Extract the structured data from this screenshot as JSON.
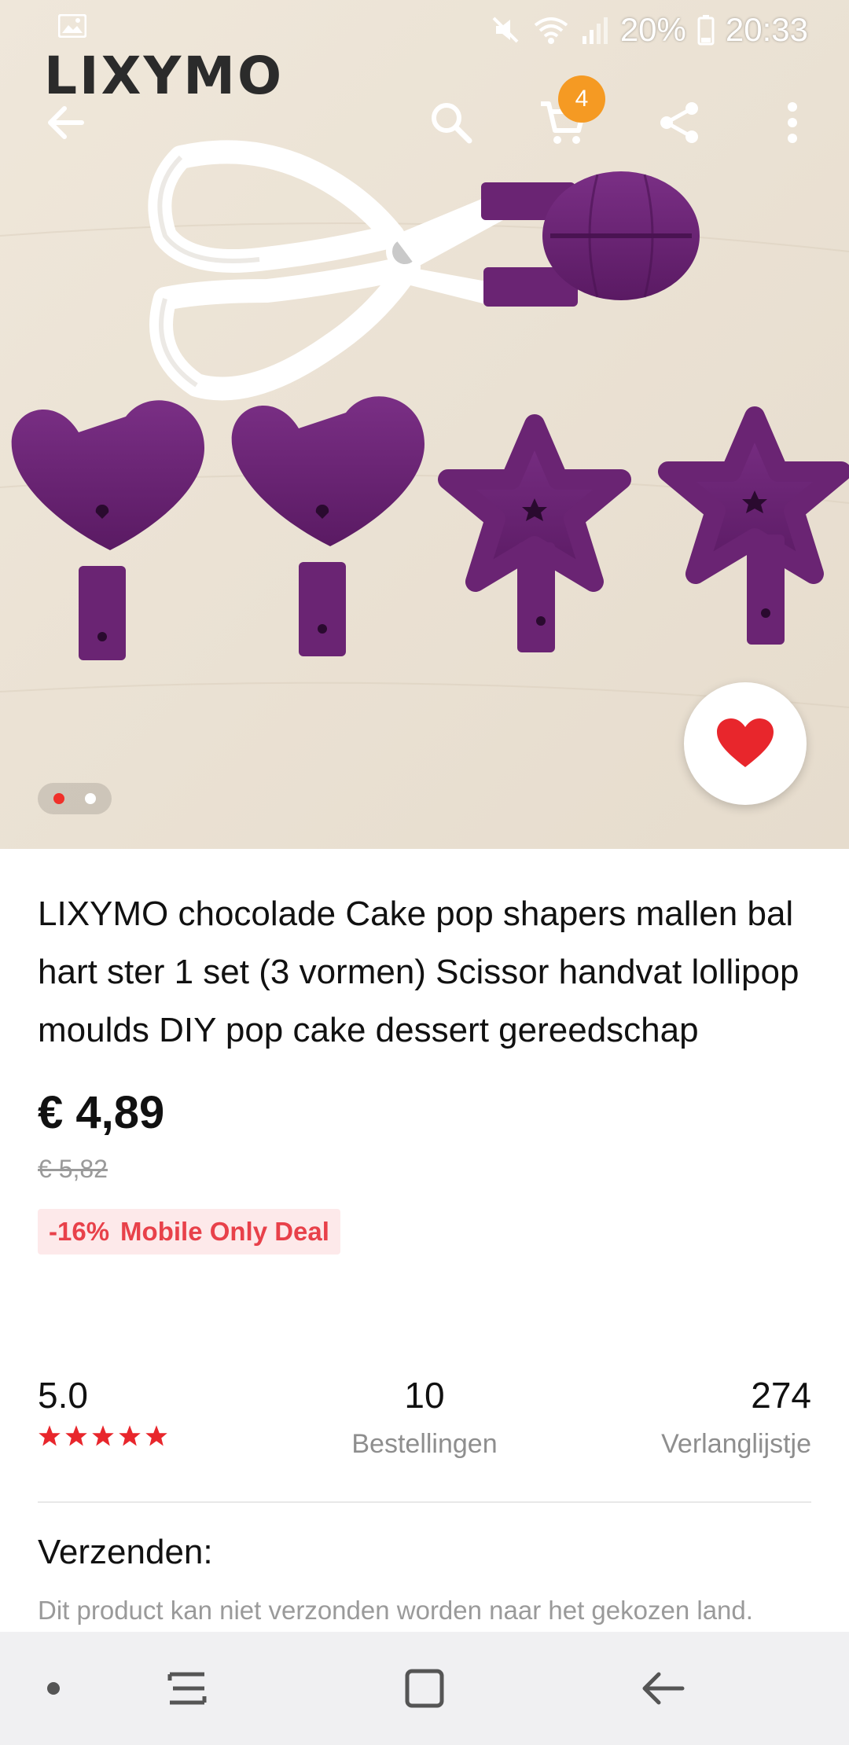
{
  "status_bar": {
    "battery": "20%",
    "time": "20:33",
    "icons": [
      "gallery-icon",
      "mute-icon",
      "wifi-icon",
      "signal-icon",
      "battery-icon"
    ]
  },
  "brand": {
    "logo_text": "LIXYMO"
  },
  "top_nav": {
    "icons": [
      "back-arrow-icon",
      "search-icon",
      "cart-icon",
      "share-icon",
      "more-vert-icon"
    ],
    "cart_count": "4"
  },
  "gallery": {
    "pages": 2,
    "active_index": 0
  },
  "favorite": {
    "icon": "heart-icon",
    "color": "#e8262c"
  },
  "product": {
    "title": "LIXYMO chocolade Cake pop shapers mallen bal hart ster 1 set (3 vormen) Scissor handvat lollipop moulds DIY pop cake dessert gereedschap",
    "price": "€ 4,89",
    "old_price": "€ 5,82",
    "discount": "-16%",
    "deal_label": "Mobile Only Deal",
    "deal_color": "#e8414a"
  },
  "stats": {
    "rating": "5.0",
    "stars": 5,
    "orders_value": "10",
    "orders_label": "Bestellingen",
    "wishlist_value": "274",
    "wishlist_label": "Verlanglijstje"
  },
  "shipping": {
    "heading": "Verzenden:",
    "text": "Dit product kan niet verzonden worden naar het gekozen land."
  },
  "system_nav": {
    "icons": [
      "dot-icon",
      "recent-apps-icon",
      "home-icon",
      "back-icon"
    ]
  }
}
